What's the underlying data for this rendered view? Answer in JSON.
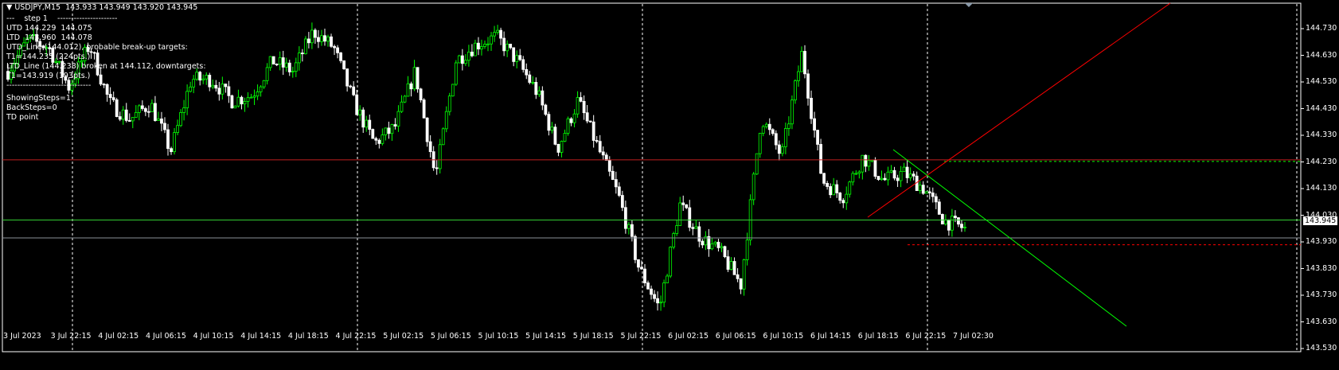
{
  "header": {
    "symbol": "USDJPY,M15",
    "ohlc": "143.933 143.949 143.920 143.945"
  },
  "info_lines": [
    "---    step 1    ----------------------",
    "UTD 144.229  144.075",
    "LTD  143.960  144.078",
    "UTD_Line (144.012), probable break-up targets:",
    "T1=144.235 (224pts.)",
    "LTD_Line (144.238) broken at 144.112, downtargets:",
    "T1=143.919 (193pts.)",
    "-------------------------------",
    "ShowingSteps=1",
    "BackSteps=0",
    "TD point"
  ],
  "current_price": "143.945",
  "colors": {
    "bull": "#00ff00",
    "bear": "#ffffff",
    "red": "#ff0000",
    "green": "#00ff00",
    "grid": "#ffffff"
  },
  "chart_data": {
    "type": "candlestick",
    "symbol": "USDJPY",
    "timeframe": "M15",
    "ylim": [
      143.51,
      144.82
    ],
    "y_ticks": [
      "144.730",
      "144.630",
      "144.530",
      "144.430",
      "144.330",
      "144.230",
      "144.130",
      "144.030",
      "143.930",
      "143.830",
      "143.730",
      "143.630",
      "143.530"
    ],
    "x_ticks": [
      "3 Jul 2023",
      "3 Jul 22:15",
      "4 Jul 02:15",
      "4 Jul 06:15",
      "4 Jul 10:15",
      "4 Jul 14:15",
      "4 Jul 18:15",
      "4 Jul 22:15",
      "5 Jul 02:15",
      "5 Jul 06:15",
      "5 Jul 10:15",
      "5 Jul 14:15",
      "5 Jul 18:15",
      "5 Jul 22:15",
      "6 Jul 02:15",
      "6 Jul 06:15",
      "6 Jul 10:15",
      "6 Jul 14:15",
      "6 Jul 18:15",
      "6 Jul 22:15",
      "7 Jul 02:30"
    ],
    "approx_close_path": [
      144.57,
      144.69,
      144.66,
      144.51,
      144.67,
      144.45,
      144.39,
      144.45,
      144.27,
      144.54,
      144.54,
      144.46,
      144.48,
      144.61,
      144.57,
      144.72,
      144.66,
      144.45,
      144.3,
      144.36,
      144.57,
      144.17,
      144.61,
      144.67,
      144.7,
      144.61,
      144.49,
      144.28,
      144.46,
      144.28,
      144.1,
      143.83,
      143.68,
      144.07,
      143.95,
      143.89,
      143.77,
      144.4,
      144.25,
      144.64,
      144.16,
      144.1,
      144.25,
      144.16,
      144.19,
      144.13,
      144.01,
      143.98
    ],
    "levels": {
      "ltd_line": 144.238,
      "utd_line": 144.012,
      "current": 143.945,
      "target_down": 143.919,
      "target_up": 144.235
    }
  }
}
